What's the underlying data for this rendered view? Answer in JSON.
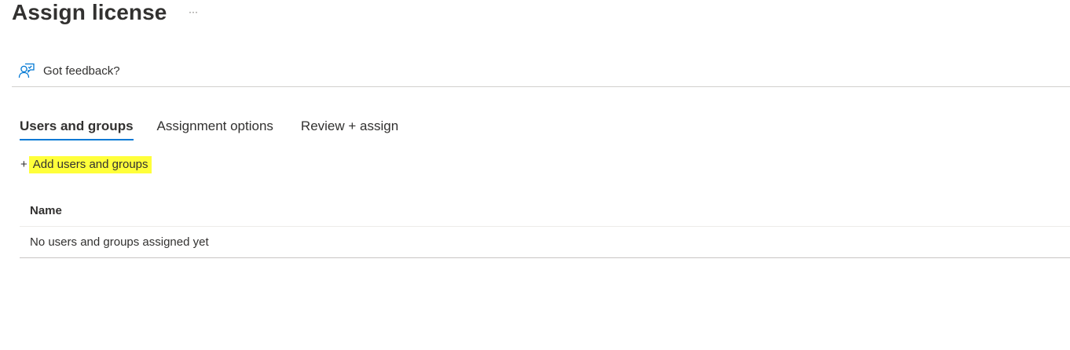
{
  "header": {
    "title": "Assign license",
    "more_label": "···"
  },
  "toolbar": {
    "feedback_label": "Got feedback?",
    "feedback_icon": "feedback-person-icon"
  },
  "tabs": [
    {
      "label": "Users and groups",
      "active": true
    },
    {
      "label": "Assignment options",
      "active": false
    },
    {
      "label": "Review + assign",
      "active": false
    }
  ],
  "actions": {
    "add_icon": "+",
    "add_label": "Add users and groups",
    "highlight_color": "#ffff3a"
  },
  "table": {
    "columns": [
      "Name"
    ],
    "empty_message": "No users and groups assigned yet"
  },
  "colors": {
    "accent": "#0078d4",
    "text": "#323130"
  }
}
